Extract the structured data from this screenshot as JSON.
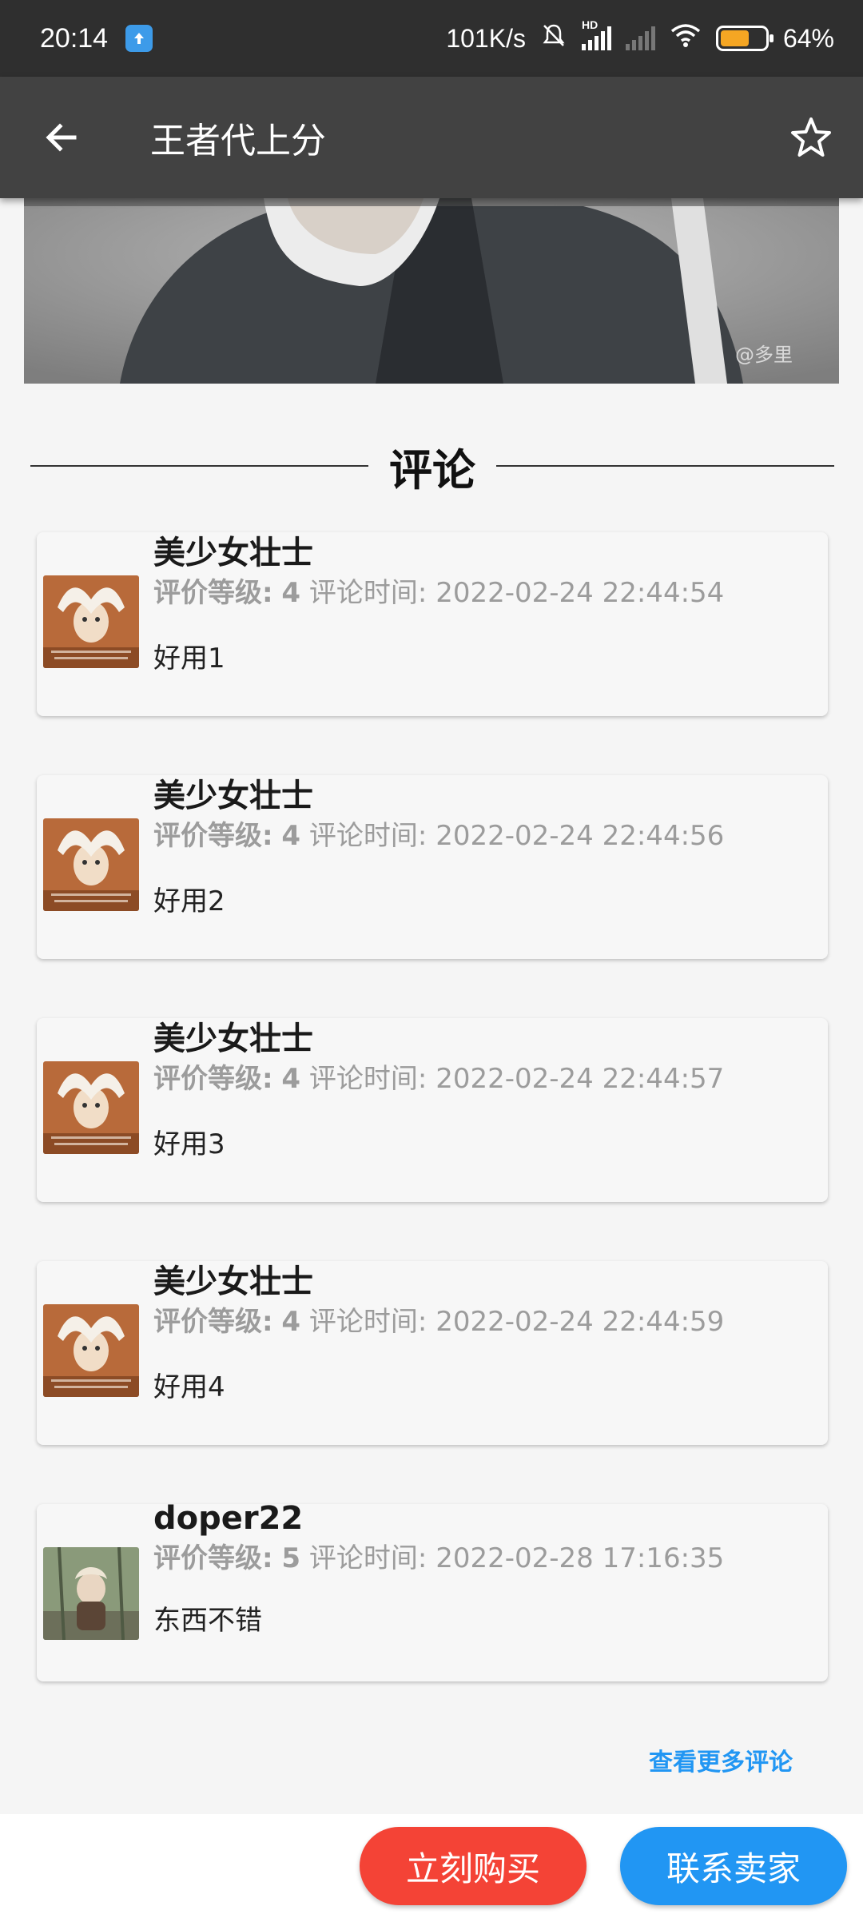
{
  "status_bar": {
    "time": "20:14",
    "network_speed": "101K/s",
    "network_label": "HD",
    "battery": "64%",
    "battery_level": 0.64,
    "icons": [
      "upload-app-icon",
      "mute-bell-icon",
      "signal-icon",
      "signal-dim-icon",
      "wifi-icon",
      "battery-icon"
    ]
  },
  "app_bar": {
    "title": "王者代上分",
    "back_icon": "arrow-back-icon",
    "favorite_icon": "star-outline-icon"
  },
  "comments": {
    "heading": "评论",
    "rating_label": "评价等级:",
    "time_label": "评论时间:",
    "items": [
      {
        "user": "美少女壮士",
        "rating": "4",
        "time": "2022-02-24 22:44:54",
        "text": "好用1"
      },
      {
        "user": "美少女壮士",
        "rating": "4",
        "time": "2022-02-24 22:44:56",
        "text": "好用2"
      },
      {
        "user": "美少女壮士",
        "rating": "4",
        "time": "2022-02-24 22:44:57",
        "text": "好用3"
      },
      {
        "user": "美少女壮士",
        "rating": "4",
        "time": "2022-02-24 22:44:59",
        "text": "好用4"
      },
      {
        "user": "doper22",
        "rating": "5",
        "time": "2022-02-28 17:16:35",
        "text": "东西不错"
      }
    ],
    "more_link": "查看更多评论"
  },
  "actions": {
    "buy_label": "立刻购买",
    "contact_label": "联系卖家"
  },
  "colors": {
    "app_bar": "#424242",
    "status_bar": "#2f2f2f",
    "buy": "#f44336",
    "contact": "#2196f3",
    "link": "#2196f3"
  }
}
